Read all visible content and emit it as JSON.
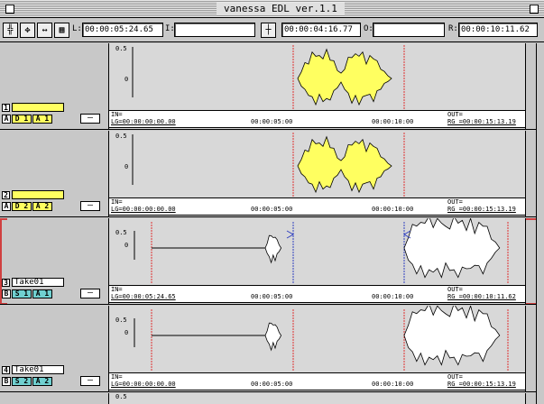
{
  "window": {
    "title": "vanessa EDL ver.1.1"
  },
  "toolbar": {
    "l_label": "L:",
    "l_value": "00:00:05:24.65",
    "i_label": "I:",
    "i_value": "",
    "mid_value": "00:00:04:16.77",
    "o_label": "O:",
    "o_value": "",
    "r_label": "R:",
    "r_value": "00:00:10:11.62"
  },
  "tracks": [
    {
      "num": "1",
      "name": "",
      "side": "A",
      "d": "D 1",
      "a": "A 1",
      "in": "IN=",
      "lg": "LG=00:00:00:00.00",
      "mid": "00:00:05:00",
      "end": "00:00:10:00",
      "out": "OUT=",
      "rg": "RG =00:00:15:13.19",
      "y05": "0.5",
      "y0": "0",
      "fill": "#ffff60",
      "chan_colors": [
        "#ffff60",
        "#ffff60"
      ]
    },
    {
      "num": "2",
      "name": "",
      "side": "A",
      "d": "D 2",
      "a": "A 2",
      "in": "IN=",
      "lg": "LG=00:00:00:00.00",
      "mid": "00:00:05:00",
      "end": "00:00:10:00",
      "out": "OUT=",
      "rg": "RG =00:00:15:13.19",
      "y05": "0.5",
      "y0": "0",
      "fill": "#ffff60",
      "chan_colors": [
        "#ffff60",
        "#ffff60"
      ]
    },
    {
      "num": "3",
      "name": "Take01",
      "side": "B",
      "d": "S 1",
      "a": "A 1",
      "in": "IN=",
      "lg": "LG=00:00:05:24.65",
      "mid": "00:00:05:00",
      "end": "00:00:10:00",
      "out": "OUT=",
      "rg": "RG =00:00:10:11.62",
      "y05": "0.5",
      "y0": "0",
      "fill": "#ffffff",
      "chan_colors": [
        "#70d0d0",
        "#70d0d0"
      ]
    },
    {
      "num": "4",
      "name": "Take01",
      "side": "B",
      "d": "S 2",
      "a": "A 2",
      "in": "IN=",
      "lg": "LG=00:00:00:00.00",
      "mid": "00:00:05:00",
      "end": "00:00:10:00",
      "out": "OUT=",
      "rg": "RG =00:00:15:13.19",
      "y05": "0.5",
      "y0": "0",
      "fill": "#ffffff",
      "chan_colors": [
        "#70d0d0",
        "#70d0d0"
      ]
    }
  ],
  "partial_track": {
    "y05": "0.5"
  },
  "colors": {
    "selected_outline": "#d04040",
    "marker": "#e03030",
    "cursor": "#3040c0"
  }
}
